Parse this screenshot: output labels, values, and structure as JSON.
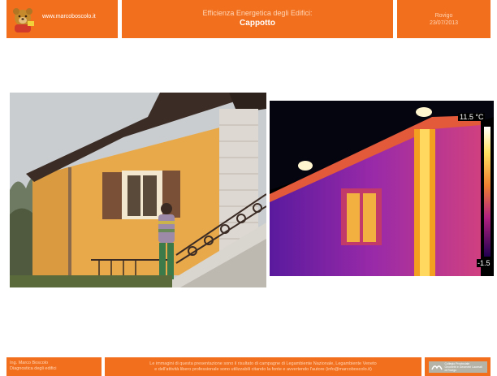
{
  "header": {
    "site": "www.marcoboscolo.it",
    "course": "Efficienza Energetica degli Edifici:",
    "title": "Cappotto",
    "place": "Rovigo",
    "date": "23/07/2013"
  },
  "thermal": {
    "max_label": "11.5 °C",
    "min_label": "-1.5"
  },
  "footer": {
    "author": "Ing. Marco Boscolo",
    "subtitle": "Diagnostica degli edifici",
    "notice_line1": "Le immagini di questa presentazione sono il risultato di campagne di Legambiente Nazionale, Legambiente Veneto",
    "notice_line2": "e dell'attività libero professionale sono utilizzabili citando la fonte e avvertendo l'autore (info@marcoboscolo.it)",
    "badge_line1": "Collegio Provinciale",
    "badge_line2": "Geometri e Geometri Laureati",
    "badge_line3": "di Rovigo"
  },
  "colors": {
    "accent": "#f26f1d",
    "accent_text": "#ffd7b8"
  }
}
